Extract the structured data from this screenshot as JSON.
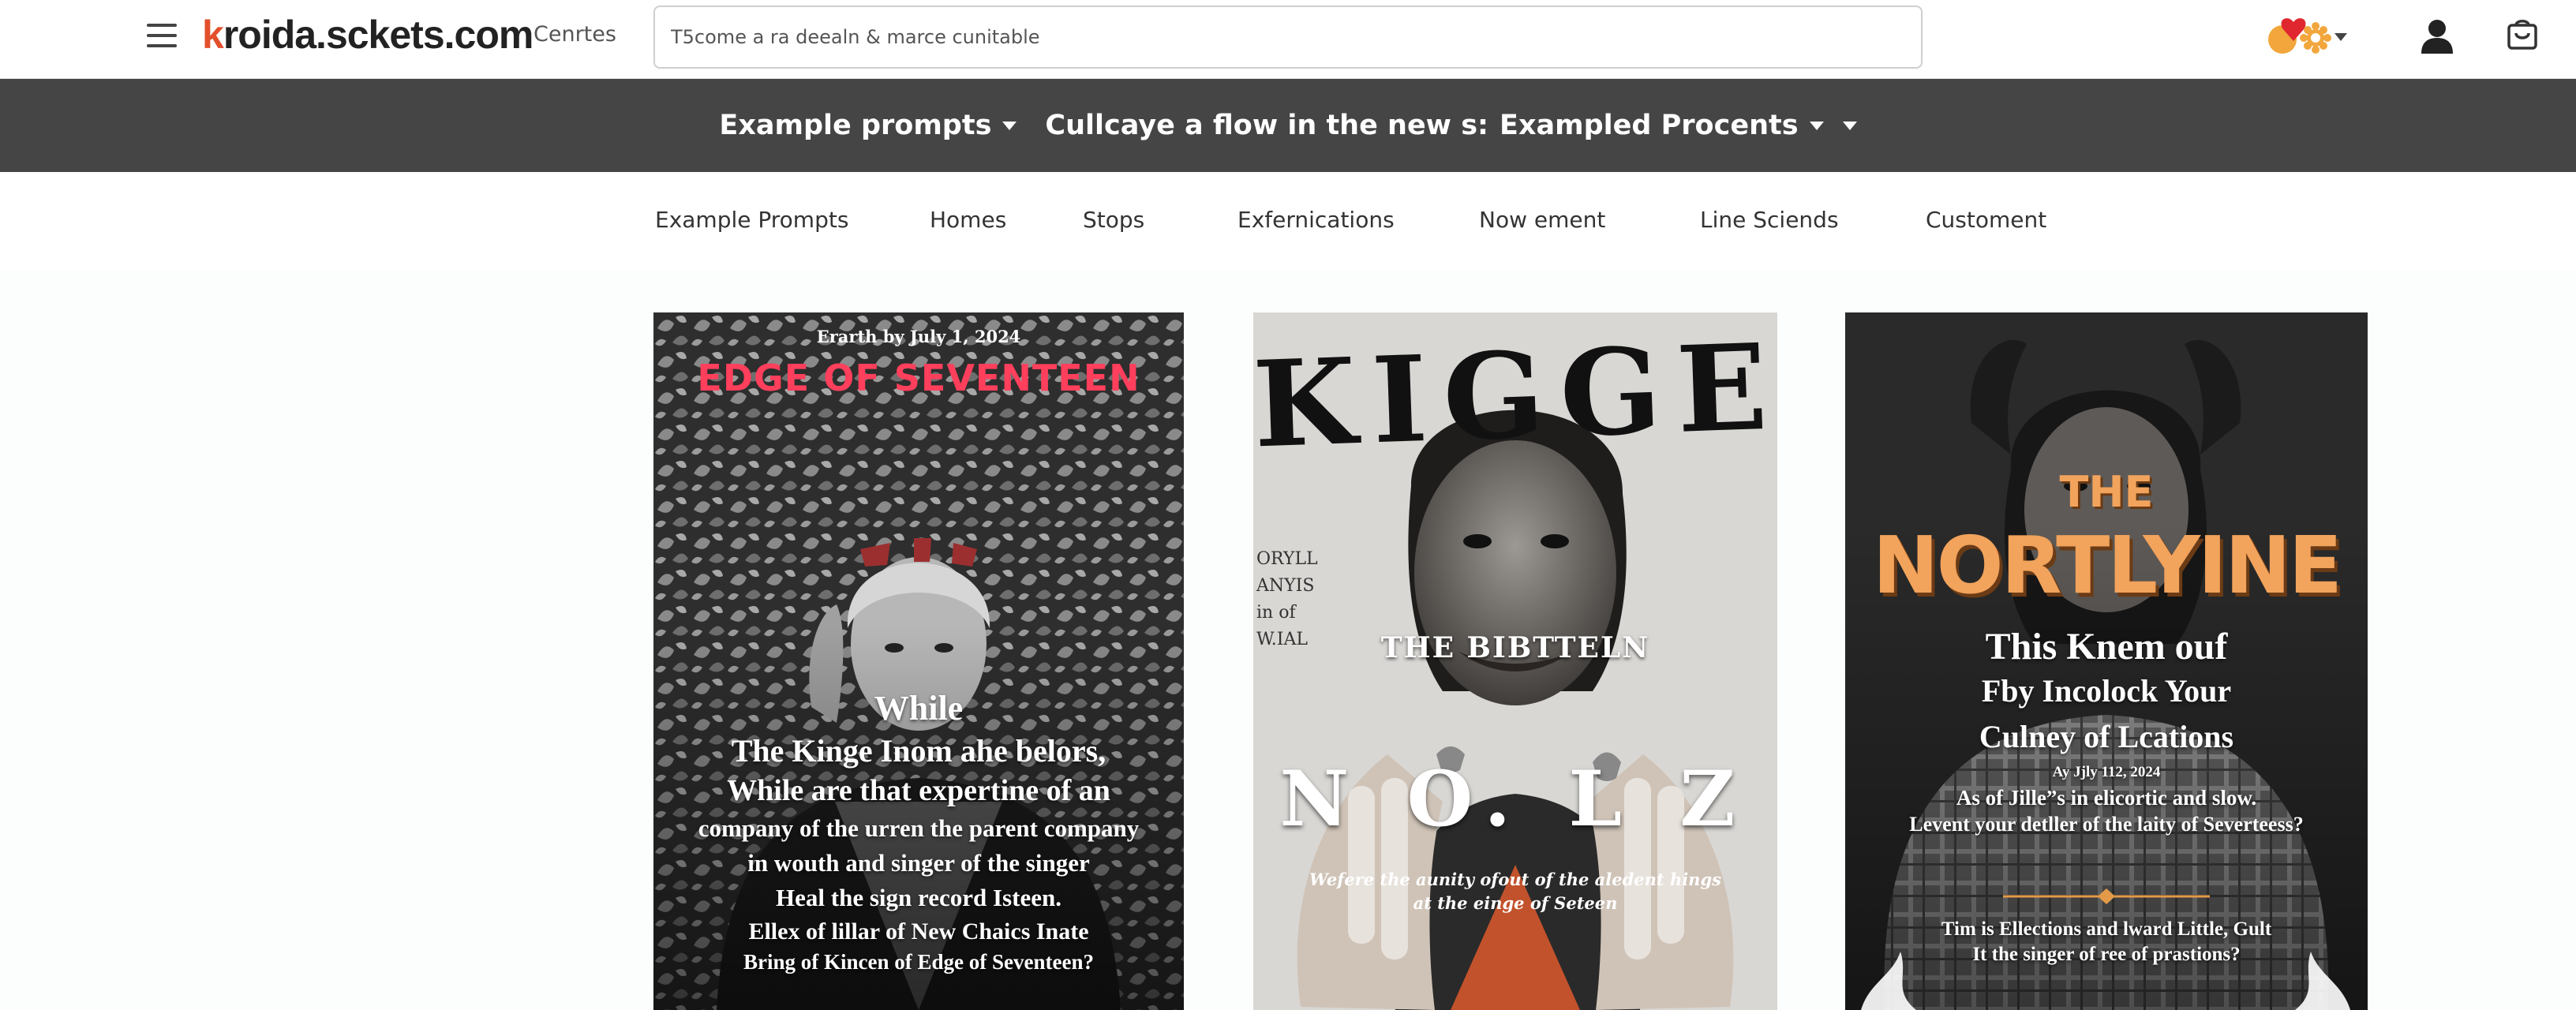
{
  "header": {
    "logo_prefix": "k",
    "logo_text": "roida.sckets.com",
    "centres": "Cenrtes",
    "search_value": "T5come a ra deealn & marce cunitable"
  },
  "subheader": {
    "item1": "Example prompts",
    "item2": "Cullcaye a flow in the new s:",
    "item3": "Exampled Procents"
  },
  "nav": {
    "items": [
      "Example Prompts",
      "Homes",
      "Stops",
      "Exfernications",
      "Now ement",
      "Line Sciends",
      "Customent"
    ]
  },
  "cards": [
    {
      "date": "Erarth by July 1, 2024",
      "title": "EDGE OF SEVENTEEN",
      "lines": [
        "While",
        "The Kinge Inom ahe belors,",
        "While are that expertine of an",
        "company of the urren the parent company",
        "in wouth and singer of the singer",
        "Heal the sign record Isteen.",
        "Ellex of lillar of New Chaics Inate",
        "Bring of Kincen of Edge of Seventeen?"
      ]
    },
    {
      "masthead": "KIGGEN",
      "side": [
        "ORYLL",
        "ANYIS",
        "in of",
        "W.IAL"
      ],
      "subtitle": "THE BIBTTELN",
      "big": "N O. L Z",
      "small": [
        "Wefere the aunity ofout of the aledent hings",
        "at the einge of Seteen"
      ]
    },
    {
      "pre": "THE",
      "title": "NORTLYINE",
      "lines": [
        "This Knem ouf",
        "Fby Incolock Your",
        "Culney of Lcations"
      ],
      "date": "Ay Jjly 112, 2024",
      "body": [
        "As of Jille”s in elicortic and slow.",
        "Levent your detller of the laity of Severteess?"
      ],
      "foot": [
        "Tim is Ellections and lward Little, Gult",
        "It the singer of ree of prastions?"
      ]
    }
  ],
  "colors": {
    "darkbar": "#454545",
    "card1_title": "#ff3f5b",
    "card3_title": "#f2a35c"
  },
  "icons": {
    "menu": "hamburger-icon",
    "notifications": "heart-badge-icon",
    "user": "user-icon",
    "cart": "bag-icon"
  }
}
